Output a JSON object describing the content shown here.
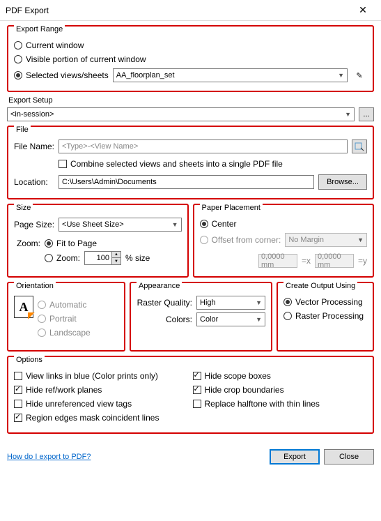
{
  "title": "PDF Export",
  "exportRange": {
    "legend": "Export Range",
    "opts": {
      "current": "Current window",
      "visible": "Visible portion of current window",
      "selected": "Selected views/sheets"
    },
    "setSelect": "AA_floorplan_set"
  },
  "exportSetup": {
    "label": "Export Setup",
    "value": "<in-session>",
    "ellipsis": "..."
  },
  "file": {
    "legend": "File",
    "fileNameLabel": "File Name:",
    "fileNamePlaceholder": "<Type>-<View Name>",
    "combine": "Combine selected views and sheets into a single PDF file",
    "locationLabel": "Location:",
    "locationValue": "C:\\Users\\Admin\\Documents",
    "browse": "Browse..."
  },
  "size": {
    "legend": "Size",
    "pageSizeLabel": "Page Size:",
    "pageSizeValue": "<Use Sheet Size>",
    "zoomLabel": "Zoom:",
    "fit": "Fit to Page",
    "zoomPct": "100",
    "pctSuffix": "% size",
    "zoomOpt": "Zoom:"
  },
  "paper": {
    "legend": "Paper Placement",
    "center": "Center",
    "offset": "Offset from corner:",
    "marginValue": "No Margin",
    "offX": "0,0000 mm",
    "offY": "0,0000 mm",
    "eqX": "=x",
    "eqY": "=y"
  },
  "orientation": {
    "legend": "Orientation",
    "auto": "Automatic",
    "portrait": "Portrait",
    "landscape": "Landscape",
    "iconLetter": "A"
  },
  "appearance": {
    "legend": "Appearance",
    "rasterLabel": "Raster Quality:",
    "rasterValue": "High",
    "colorsLabel": "Colors:",
    "colorsValue": "Color"
  },
  "output": {
    "legend": "Create Output Using",
    "vector": "Vector Processing",
    "raster": "Raster Processing"
  },
  "options": {
    "legend": "Options",
    "viewLinks": "View links in blue (Color prints only)",
    "hideScope": "Hide scope boxes",
    "hideRef": "Hide ref/work planes",
    "hideCrop": "Hide crop boundaries",
    "hideUnref": "Hide unreferenced view tags",
    "replaceHalf": "Replace halftone with thin lines",
    "regionEdges": "Region edges mask coincident lines"
  },
  "footer": {
    "help": "How do I export to PDF?",
    "export": "Export",
    "close": "Close"
  }
}
